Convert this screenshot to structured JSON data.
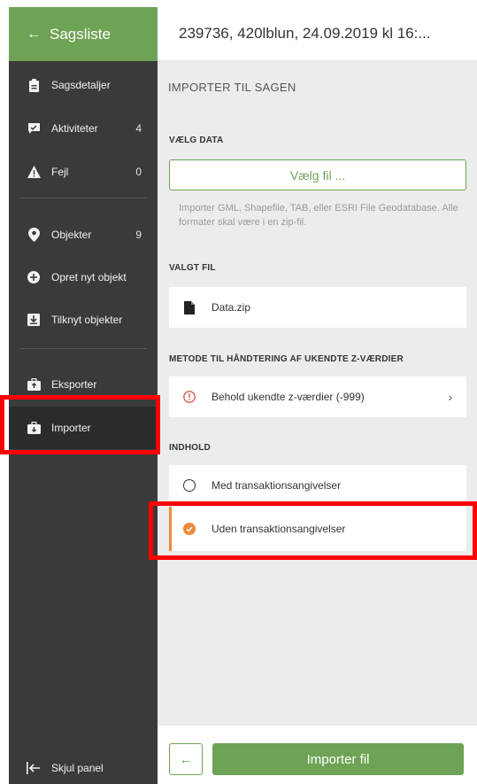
{
  "sidebar": {
    "header_label": "Sagsliste",
    "items": [
      {
        "label": "Sagsdetaljer",
        "count": ""
      },
      {
        "label": "Aktiviteter",
        "count": "4"
      },
      {
        "label": "Fejl",
        "count": "0"
      },
      {
        "label": "Objekter",
        "count": "9"
      },
      {
        "label": "Opret nyt objekt",
        "count": ""
      },
      {
        "label": "Tilknyt objekter",
        "count": ""
      },
      {
        "label": "Eksporter",
        "count": ""
      },
      {
        "label": "Importer",
        "count": ""
      }
    ],
    "hide_panel_label": "Skjul panel"
  },
  "header": {
    "title": "239736, 420lblun, 24.09.2019 kl 16:..."
  },
  "main": {
    "section_title": "IMPORTER TIL SAGEN",
    "choose_data_label": "VÆLG DATA",
    "choose_file_button": "Vælg fil ...",
    "help_text": "Importer GML, Shapefile, TAB, eller ESRI File Geodatabase. Alle formater skal være i en zip-fil.",
    "selected_file_label": "VALGT FIL",
    "selected_file_name": "Data.zip",
    "method_label": "METODE TIL HÅNDTERING AF UKENDTE Z-VÆRDIER",
    "method_value": "Behold ukendte z-værdier (-999)",
    "content_label": "INDHOLD",
    "content_options": [
      {
        "label": "Med transaktionsangivelser",
        "selected": false
      },
      {
        "label": "Uden transaktionsangivelser",
        "selected": true
      }
    ]
  },
  "footer": {
    "import_button": "Importer fil"
  },
  "colors": {
    "brand_green": "#6ea355",
    "accent_orange": "#ef8a3c",
    "sidebar_bg": "#3a3a3a",
    "highlight_red": "#ff0000"
  }
}
